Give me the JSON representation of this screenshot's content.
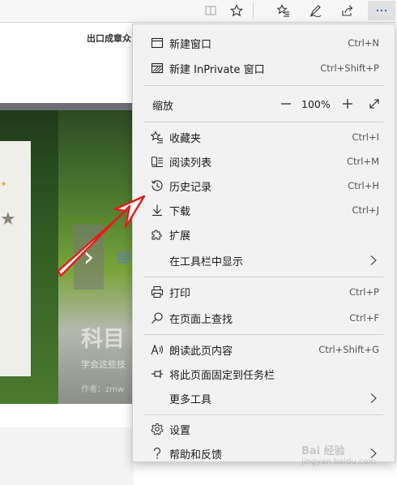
{
  "page": {
    "header_text": "出口成章众",
    "hero_title": "科目",
    "hero_subtitle": "学会这些技",
    "hero_author": "作者：zmw"
  },
  "menu": {
    "new_window": {
      "label": "新建窗口",
      "shortcut": "Ctrl+N"
    },
    "new_inprivate": {
      "label": "新建 InPrivate 窗口",
      "shortcut": "Ctrl+Shift+P"
    },
    "zoom": {
      "label": "缩放",
      "value": "100%"
    },
    "favorites": {
      "label": "收藏夹",
      "shortcut": "Ctrl+I"
    },
    "reading_list": {
      "label": "阅读列表",
      "shortcut": "Ctrl+M"
    },
    "history": {
      "label": "历史记录",
      "shortcut": "Ctrl+H"
    },
    "downloads": {
      "label": "下载",
      "shortcut": "Ctrl+J"
    },
    "extensions": {
      "label": "扩展"
    },
    "show_in_toolbar": {
      "label": "在工具栏中显示"
    },
    "print": {
      "label": "打印",
      "shortcut": "Ctrl+P"
    },
    "find": {
      "label": "在页面上查找",
      "shortcut": "Ctrl+F"
    },
    "read_aloud": {
      "label": "朗读此页内容",
      "shortcut": "Ctrl+Shift+G"
    },
    "pin_taskbar": {
      "label": "将此页面固定到任务栏"
    },
    "more_tools": {
      "label": "更多工具"
    },
    "settings": {
      "label": "设置"
    },
    "help": {
      "label": "帮助和反馈"
    }
  },
  "watermark": {
    "text": "Bai 经验",
    "sub": "jingyan.baidu.com"
  },
  "colors": {
    "annotation_arrow": "#e0201c",
    "menu_bg": "#f2f2f2"
  }
}
